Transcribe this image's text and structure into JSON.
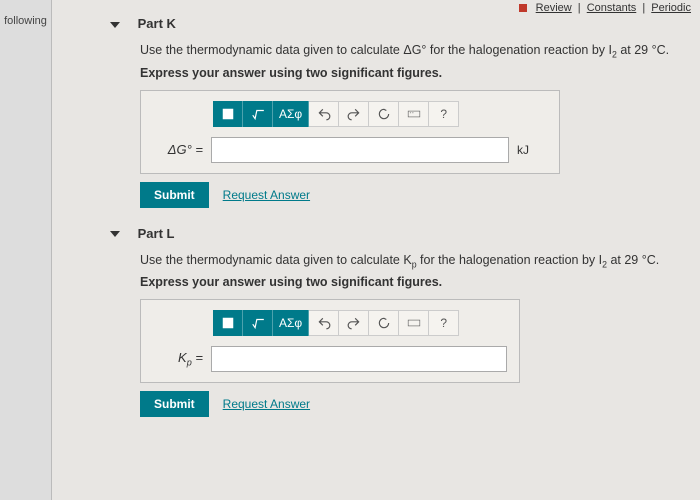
{
  "sidebar": {
    "text": "following"
  },
  "topbar": {
    "review": "Review",
    "constants": "Constants",
    "periodic": "Periodic"
  },
  "partK": {
    "header": "Part K",
    "instruction_prefix": "Use the thermodynamic data given to calculate ",
    "instruction_var": "ΔG°",
    "instruction_mid": " for the halogenation reaction by I",
    "instruction_sub": "2",
    "instruction_suffix": " at 29 °C.",
    "express": "Express your answer using two significant figures.",
    "var_label": "ΔG° =",
    "unit": "kJ",
    "toolbar": {
      "sigma": "ΑΣφ",
      "help": "?"
    },
    "submit": "Submit",
    "request": "Request Answer"
  },
  "partL": {
    "header": "Part L",
    "instruction_prefix": "Use the thermodynamic data given to calculate ",
    "instruction_var": "K",
    "instruction_varsub": "p",
    "instruction_mid": " for the halogenation reaction by I",
    "instruction_sub": "2",
    "instruction_suffix": " at 29 °C.",
    "express": "Express your answer using two significant figures.",
    "var_label_k": "K",
    "var_label_sub": "p",
    "var_label_eq": " =",
    "toolbar": {
      "sigma": "ΑΣφ",
      "help": "?"
    },
    "submit": "Submit",
    "request": "Request Answer"
  }
}
